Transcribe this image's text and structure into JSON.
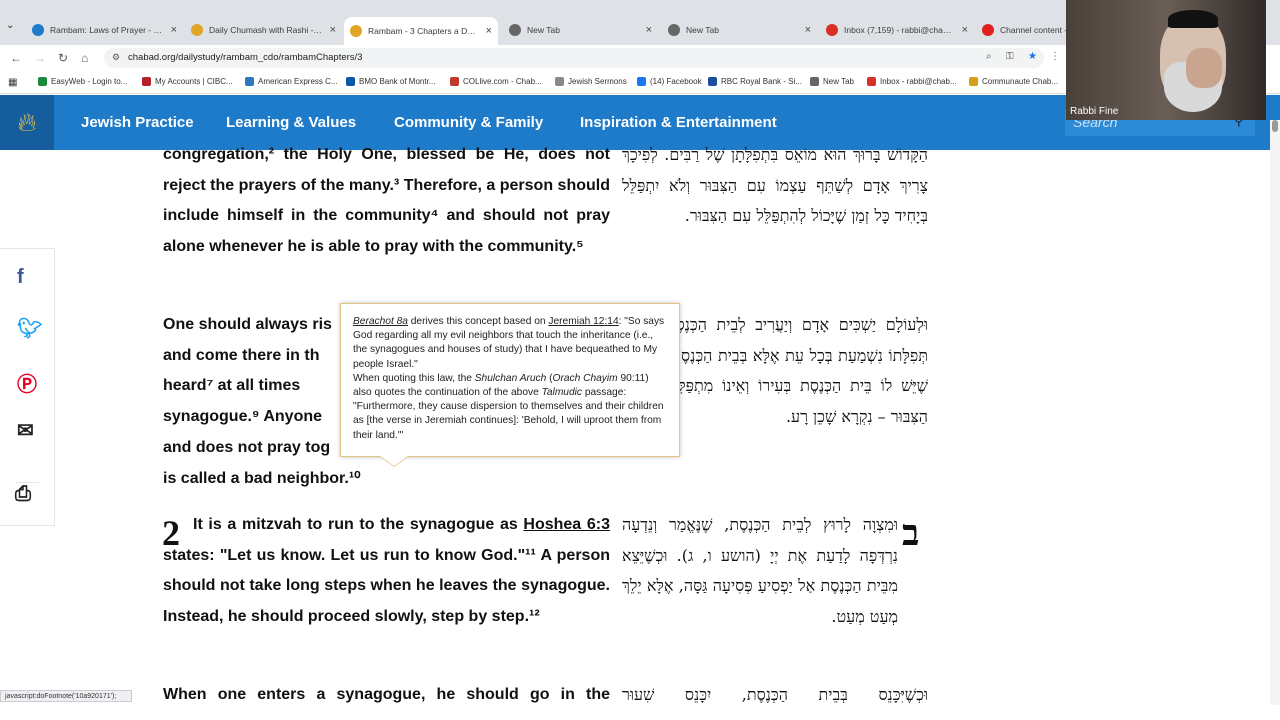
{
  "browser": {
    "tabs": [
      {
        "title": "Rambam: Laws of Prayer - Res",
        "color": "#1e7bc9"
      },
      {
        "title": "Daily Chumash with Rashi - Chu",
        "color": "#e0a526"
      },
      {
        "title": "Rambam - 3 Chapters a Day - I",
        "color": "#e0a526"
      },
      {
        "title": "New Tab",
        "color": "#666"
      },
      {
        "title": "New Tab",
        "color": "#666"
      },
      {
        "title": "Inbox (7,159) - rabbi@chabad.",
        "color": "#d93025"
      },
      {
        "title": "Channel content - Y",
        "color": "#e02020"
      }
    ],
    "url": "chabad.org/dailystudy/rambam_cdo/rambamChapters/3",
    "bookmarks": [
      {
        "label": "EasyWeb - Login to...",
        "color": "#1a8a3a"
      },
      {
        "label": "My Accounts | CIBC...",
        "color": "#b3202a"
      },
      {
        "label": "American Express C...",
        "color": "#2e77bc"
      },
      {
        "label": "BMO Bank of Montr...",
        "color": "#0a58a8"
      },
      {
        "label": "COLlive.com - Chab...",
        "color": "#c0392b"
      },
      {
        "label": "Jewish Sermons",
        "color": "#888"
      },
      {
        "label": "(14) Facebook",
        "color": "#1877f2"
      },
      {
        "label": "RBC Royal Bank - Si...",
        "color": "#1d4e9c"
      },
      {
        "label": "New Tab",
        "color": "#666"
      },
      {
        "label": "Inbox - rabbi@chab...",
        "color": "#d93025"
      },
      {
        "label": "Communaute Chab...",
        "color": "#d4a017"
      }
    ],
    "status_text": "javascript:doFootnote('10a920171');"
  },
  "site": {
    "nav": [
      "Jewish Practice",
      "Learning & Values",
      "Community & Family",
      "Inspiration & Entertainment"
    ],
    "search_placeholder": "Search"
  },
  "video": {
    "participant_name": "Rabbi Fine"
  },
  "content": {
    "p1_en": "congregation,² the Holy One, blessed be He, does not reject the prayers of the many.³ Therefore, a person should include himself in the community⁴ and should not pray alone whenever he is able to pray with the community.⁵",
    "p1_he": "הַקָּדוֹשׁ בָּרוּךְ הוּא מוֹאֵס בִּתְפִלָּתָן שֶׁל רַבִּים. לְפִיכָךְ צָרִיךְ אָדָם לְשַׁתֵּף עַצְמוֹ עִם הַצִּבּוּר וְלֹא יִתְפַּלֵּל בְּיָחִיד כָּל זְמַן שֶׁיָּכוֹל לְהִתְפַּלֵּל עִם הַצִּבּוּר.",
    "p2_en": "One should always rise early and come there in the morning... heard⁷ at all times... synagogue.⁹ Anyone who has a synagogue... and does not pray together with the community... is called a bad neighbor.¹⁰",
    "p2_en_lines": [
      "One should always ris",
      "and come there in th",
      "heard⁷ at all times",
      "synagogue.⁹ Anyone",
      "and does not pray tog",
      "is called a bad neighbor.¹⁰"
    ],
    "p2_he": "וּלְעוֹלָם יַשְׁכִּים אָדָם וְיַעֲרִיב לְבֵית הַכְּנֶסֶת, שֶׁאֵין תְּפִלָּתוֹ נִשְׁמַעַת בְּכָל עֵת אֶלָּא בְּבֵית הַכְּנֶסֶת. וְכָל מִי שֶׁיֵּשׁ לוֹ בֵּית הַכְּנֶסֶת בְּעִירוֹ וְאֵינוֹ מִתְפַּלֵּל בּוֹ עִם הַצִּבּוּר – נִקְרָא שָׁכֵן רָע.",
    "p3_num": "2",
    "p3_he_num": "ב",
    "p3_en_a": "It is a mitzvah to run to the synagogue as ",
    "p3_link": "Hoshea 6:3",
    "p3_en_b": " states: \"Let us know. Let us run to know God.\"¹¹ A person should not take long steps when he leaves the synagogue. Instead, he should proceed slowly, step by step.¹²",
    "p3_he": "וּמִצְוָה לָרוּץ לְבֵית הַכְּנֶסֶת, שֶׁנֶּאֱמַר וְנֵדְעָה נִרְדְּפָה לָדַעַת אֶת יְיָ (הושע ו, ג). וּכְשֶׁיֵּצֵא מִבֵּית הַכְּנֶסֶת אַל יַפְסִיעַ פְּסִיעָה גַּסָּה, אֶלָּא יֵלֵךְ מְעַט מְעַט.",
    "p4_en": "When one enters a synagogue, he should go in the",
    "p4_he": "וּכְשֶׁיִּכָּנֵס בְּבֵית הַכְּנֶסֶת, יִכָּנֵס שִׁעוּר"
  },
  "footnote": {
    "ref1": "Berachot 8a",
    "text1": " derives this concept based on ",
    "ref2": "Jeremiah 12:14",
    "text2": ": \"So says God regarding all my evil neighbors that touch the inheritance (i.e., the synagogues and houses of study) that I have bequeathed to My people Israel.\"",
    "text3": "When quoting this law, the ",
    "italic1": "Shulchan Aruch",
    "text4": " (",
    "italic2": "Orach Chayim",
    "text5": " 90:11) also quotes the continuation of the above ",
    "italic3": "Talmudic",
    "text6": " passage: \"Furthermore, they cause dispersion to themselves and their children as [the verse in Jeremiah continues]: 'Behold, I will uproot them from their land.'\""
  }
}
